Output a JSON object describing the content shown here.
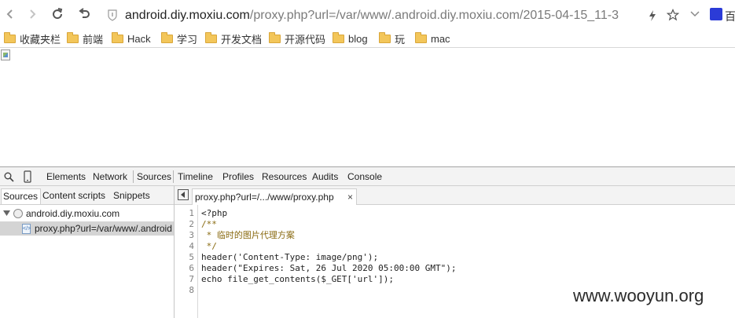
{
  "browser": {
    "url_host": "android.diy.moxiu.com",
    "url_rest": "/proxy.php?url=/var/www/.android.diy.moxiu.com/2015-04-15_11-3",
    "search_engine_label": "百"
  },
  "bookmarks": [
    {
      "label": "收藏夹栏"
    },
    {
      "label": "前端"
    },
    {
      "label": "Hack"
    },
    {
      "label": "学习"
    },
    {
      "label": "开发文档"
    },
    {
      "label": "开源代码"
    },
    {
      "label": "blog"
    },
    {
      "label": "玩"
    },
    {
      "label": "mac"
    }
  ],
  "devtools": {
    "tabs": [
      "Elements",
      "Network",
      "Sources",
      "Timeline",
      "Profiles",
      "Resources",
      "Audits",
      "Console"
    ],
    "active_tab": "Sources",
    "navigator_tabs": [
      "Sources",
      "Content scripts",
      "Snippets"
    ],
    "tree": {
      "domain": "android.diy.moxiu.com",
      "file": "proxy.php?url=/var/www/.android"
    },
    "editor_tab": "proxy.php?url=/.../www/proxy.php",
    "editor_tab_close": "×",
    "code_lines": [
      "<?php",
      "/**",
      " * 临时的图片代理方案",
      " */",
      "header('Content-Type: image/png');",
      "header(\"Expires: Sat, 26 Jul 2020 05:00:00 GMT\");",
      "echo file_get_contents($_GET['url']);",
      ""
    ],
    "line_numbers": [
      "1",
      "2",
      "3",
      "4",
      "5",
      "6",
      "7",
      "8"
    ]
  },
  "watermark": "www.wooyun.org",
  "colors": {
    "comment": "#8a6b12",
    "folder": "#f3c65a",
    "selected_row": "#d4d4d4"
  }
}
